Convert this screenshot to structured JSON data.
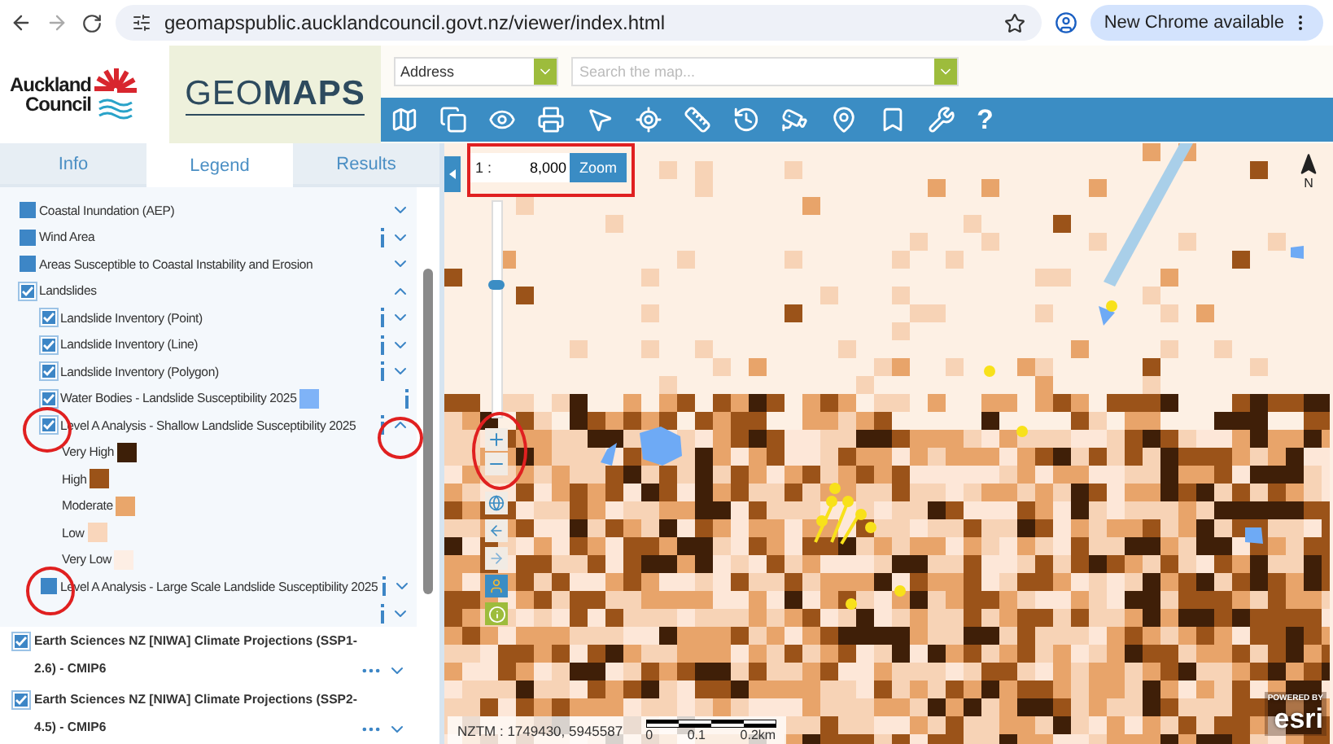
{
  "browser": {
    "url": "geomapspublic.aucklandcouncil.govt.nz/viewer/index.html",
    "update_button": "New Chrome available"
  },
  "header": {
    "logo_text": "Auckland Council",
    "app_title": "GEO**MAPS**",
    "address_select": "Address",
    "search": {
      "placeholder": "Search the map..."
    }
  },
  "toolbar": {
    "help_label": "?"
  },
  "tabs": [
    {
      "label": "Info",
      "selected": false
    },
    {
      "label": "Legend",
      "selected": true
    },
    {
      "label": "Results",
      "selected": false
    }
  ],
  "legend": [
    {
      "label": "Coastal Inundation (AEP)",
      "checked": false,
      "info": false,
      "expanded": false
    },
    {
      "label": "Wind Area",
      "checked": false,
      "info": true,
      "expanded": false
    },
    {
      "label": "Areas Susceptible to Coastal Instability and Erosion",
      "checked": false,
      "info": false,
      "expanded": false
    },
    {
      "label": "Landslides",
      "checked": true,
      "info": false,
      "expanded": true,
      "children": [
        {
          "label": "Landslide Inventory (Point)",
          "checked": true,
          "info": true,
          "expanded": false
        },
        {
          "label": "Landslide Inventory (Line)",
          "checked": true,
          "info": true,
          "expanded": false
        },
        {
          "label": "Landslide Inventory (Polygon)",
          "checked": true,
          "info": true,
          "expanded": false
        },
        {
          "label": "Water Bodies - Landslide Susceptibility 2025",
          "checked": true,
          "info": true,
          "color": "#7fb3f7"
        },
        {
          "label": "Level A Analysis - Shallow Landslide Susceptibility 2025",
          "checked": true,
          "info": true,
          "expanded": true,
          "classes": [
            {
              "label": "Very High",
              "color": "#3d1f08"
            },
            {
              "label": "High",
              "color": "#9b5318"
            },
            {
              "label": "Moderate",
              "color": "#e9a66b"
            },
            {
              "label": "Low",
              "color": "#f9d6bb"
            },
            {
              "label": "Very Low",
              "color": "#fdeee4"
            }
          ]
        },
        {
          "label": "Level A Analysis - Large Scale Landslide Susceptibility 2025",
          "checked": false,
          "info": true,
          "expanded": false
        }
      ]
    }
  ],
  "climate_layers": [
    {
      "label": "Earth Sciences NZ [NIWA] Climate Projections (SSP1-2.6) - CMIP6",
      "checked": true,
      "expanded": false
    },
    {
      "label": "Earth Sciences NZ [NIWA] Climate Projections (SSP2-4.5) - CMIP6",
      "checked": true,
      "expanded": false
    }
  ],
  "map": {
    "scale_prefix": "1 :",
    "scale_value": "8,000",
    "zoom_button": "Zoom",
    "zoom_slider": {
      "level": 0.62
    },
    "north_label": "N",
    "coordinates": "NZTM : 1749430, 5945587",
    "scale_bar": [
      "0",
      "0.1",
      "0.2km"
    ],
    "attribution_small": "POWERED BY",
    "attribution": "esri"
  }
}
